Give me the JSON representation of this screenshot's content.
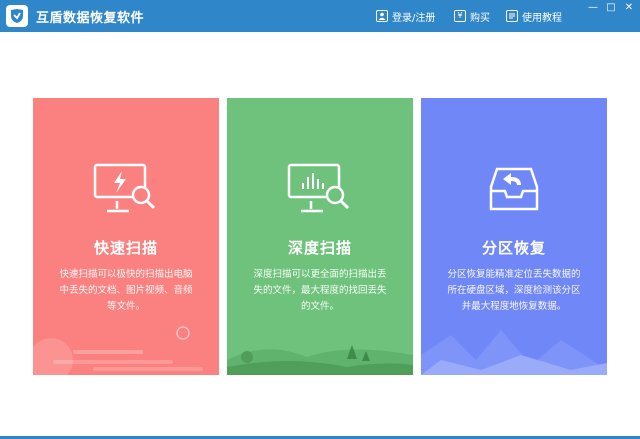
{
  "app": {
    "title": "互盾数据恢复软件",
    "brand_color": "#2f86c9"
  },
  "toolbar": {
    "login_label": "登录/注册",
    "buy_label": "购买",
    "buy_icon_glyph": "¥",
    "tutorial_label": "使用教程"
  },
  "window_controls": {
    "minimize": "—",
    "maximize": "□",
    "close": "✕"
  },
  "cards": [
    {
      "title": "快速扫描",
      "description": "快速扫描可以极快的扫描出电脑中丢失的文档、图片视频、音频等文件。",
      "color": "#fb8080",
      "icon": "monitor-lightning-search-icon"
    },
    {
      "title": "深度扫描",
      "description": "深度扫描可以更全面的扫描出丢失的文件，最大程度的找回丢失的文件。",
      "color": "#6fc27b",
      "icon": "monitor-chart-search-icon"
    },
    {
      "title": "分区恢复",
      "description": "分区恢复能精准定位丢失数据的所在硬盘区域，深度检测该分区并最大程度地恢复数据。",
      "color": "#6f87f7",
      "icon": "tray-restore-arrow-icon"
    }
  ]
}
